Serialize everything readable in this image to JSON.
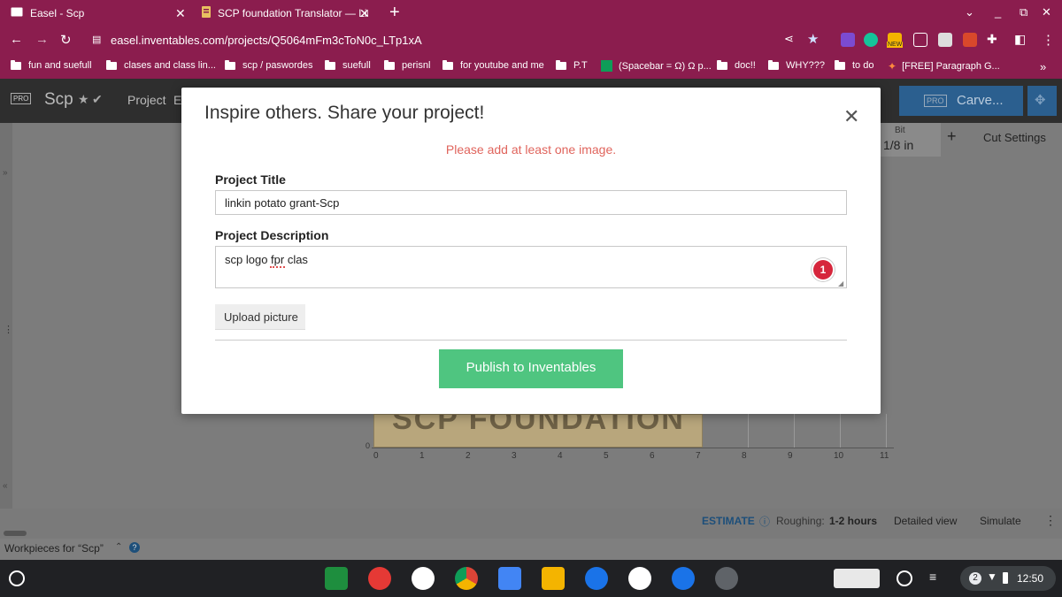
{
  "browser": {
    "tabs": [
      {
        "title": "Easel - Scp",
        "favicon": "easel-icon"
      },
      {
        "title": "SCP foundation Translator — Lin",
        "favicon": "scp-icon"
      }
    ],
    "address": "easel.inventables.com/projects/Q5064mFm3cToN0c_LTp1xA",
    "new_badge": "NEW",
    "bookmarks": [
      "fun and suefull",
      "clases and class lin...",
      "scp / paswordes",
      "suefull",
      "perisnl",
      "for youtube and me",
      "P.T",
      "(Spacebar = Ω) Ω p...",
      "doc!!",
      "WHY???",
      "to do",
      "[FREE] Paragraph G..."
    ],
    "bookmarks_more": "»"
  },
  "easel": {
    "pro_badge": "PRO",
    "project_name": "Scp",
    "menu_project": "Project",
    "menu_e": "E",
    "carve_label": "Carve...",
    "bit_label": "Bit",
    "bit_value": "1/8 in",
    "plus_label": "+",
    "cut_settings": "Cut Settings",
    "ruler": [
      "0",
      "1",
      "2",
      "3",
      "4",
      "5",
      "6",
      "7",
      "8",
      "9",
      "10",
      "11"
    ],
    "ruler_y": "0",
    "workpiece_text": "SCP FOUNDATION",
    "estimate_label": "ESTIMATE",
    "roughing_label": "Roughing:",
    "roughing_value": "1-2 hours",
    "detailed_view": "Detailed view",
    "simulate": "Simulate",
    "workpieces_label": "Workpieces for “Scp”",
    "left_expand": "»",
    "left_collapse": "«"
  },
  "modal": {
    "title": "Inspire others. Share your project!",
    "error": "Please add at least one image.",
    "project_title_label": "Project Title",
    "project_title_value": "linkin potato grant-Scp",
    "project_description_label": "Project Description",
    "project_description_value": "scp logo fpr clas",
    "grammar_count": "1",
    "upload_label": "Upload picture",
    "publish_label": "Publish to Inventables"
  },
  "shelf": {
    "notification_count": "2",
    "time": "12:50"
  },
  "colors": {
    "chrome": "#8b1d4e",
    "publish_green": "#4fc580",
    "error_red": "#e0645c",
    "carve_blue": "#2b6ea8"
  }
}
